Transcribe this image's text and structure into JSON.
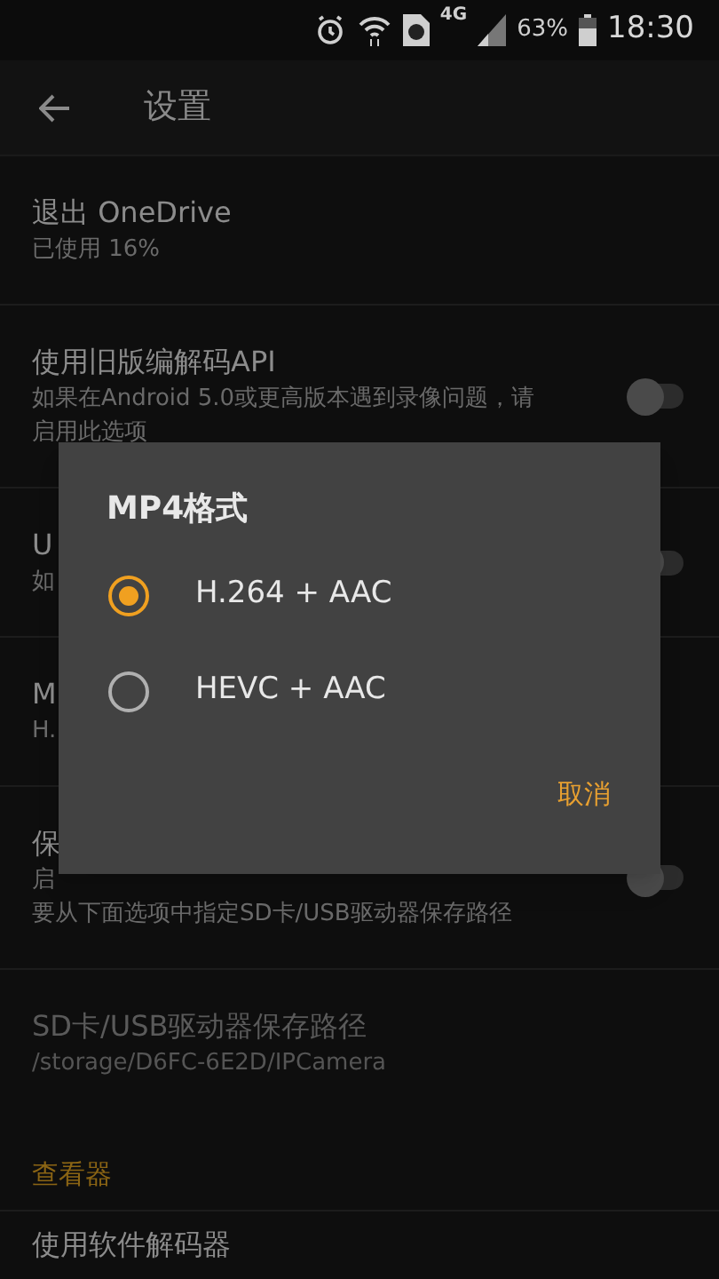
{
  "status_bar": {
    "network": "4G",
    "battery": "63%",
    "time": "18:30"
  },
  "toolbar": {
    "title": "设置"
  },
  "settings": [
    {
      "kind": "setting",
      "title": "退出 OneDrive",
      "subtitle": "已使用 16%",
      "disabled": false
    },
    {
      "kind": "setting",
      "title": "使用旧版编解码API",
      "subtitle": "如果在Android 5.0或更高版本遇到录像问题，请启用此选项",
      "disabled": false,
      "on": false
    },
    {
      "kind": "setting",
      "title": "U",
      "subtitle": "如",
      "disabled": false,
      "on": false
    },
    {
      "kind": "setting",
      "title": "M",
      "subtitle": "H.",
      "disabled": false
    },
    {
      "kind": "setting",
      "title": "保",
      "subtitle": "启",
      "subtitle_2": "要从下面选项中指定SD卡/USB驱动器保存路径",
      "disabled": false,
      "on": false
    },
    {
      "kind": "setting",
      "title": "SD卡/USB驱动器保存路径",
      "subtitle": "/storage/D6FC-6E2D/IPCamera",
      "disabled": true
    },
    {
      "kind": "section",
      "title": "查看器"
    },
    {
      "kind": "setting",
      "title": "使用软件解码器",
      "disabled": false
    }
  ],
  "dialog": {
    "title": "MP4格式",
    "options": [
      {
        "label": "H.264 + AAC",
        "selected": true
      },
      {
        "label": "HEVC + AAC",
        "selected": false
      }
    ],
    "cancel": "取消"
  }
}
